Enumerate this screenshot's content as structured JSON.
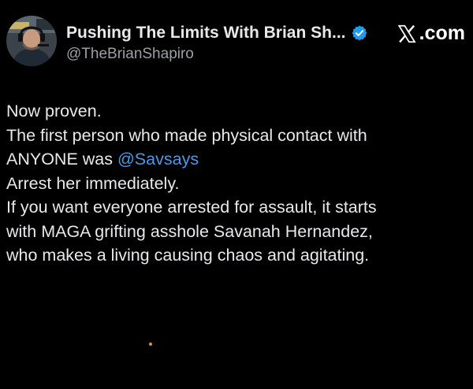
{
  "author": {
    "display_name": "Pushing The Limits With Brian Sh...",
    "handle": "@TheBrianShapiro",
    "verified": true,
    "avatar_icon": "avatar-man-headset"
  },
  "brand": {
    "label": ".com",
    "icon": "x-logo-icon"
  },
  "post": {
    "line1": "Now proven.",
    "line2": "The first person who made physical contact with",
    "line3_prefix": "ANYONE was ",
    "mention": "@Savsays",
    "line4": "Arrest her immediately.",
    "line5": "If you want everyone arrested for assault, it starts",
    "line6": "with MAGA grifting asshole Savanah Hernandez,",
    "line7": "who makes a living causing chaos and agitating."
  },
  "colors": {
    "background": "#000000",
    "text": "#e7e9ea",
    "mention": "#4a99e9",
    "verified_badge": "#1d9bf0",
    "handle": "#9aa0a6"
  }
}
